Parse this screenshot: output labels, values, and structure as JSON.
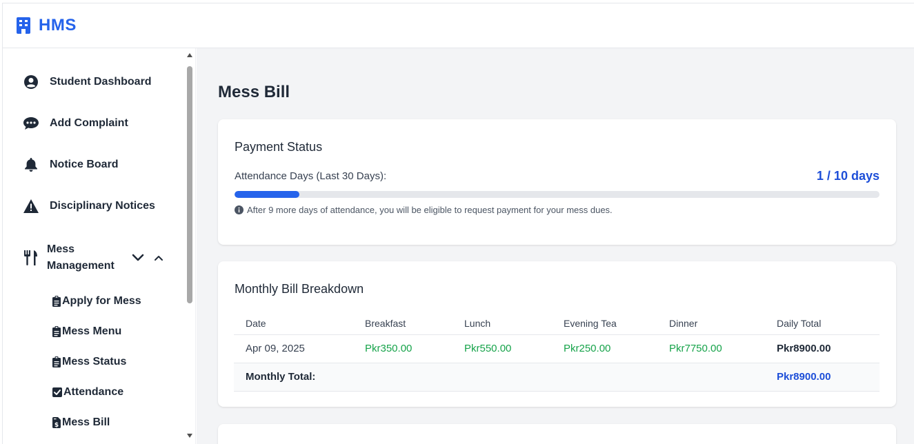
{
  "app": {
    "brand": "HMS"
  },
  "sidebar": {
    "items": [
      {
        "label": "Student Dashboard",
        "icon": "user-circle-icon"
      },
      {
        "label": "Add Complaint",
        "icon": "comment-dots-icon"
      },
      {
        "label": "Notice Board",
        "icon": "bell-icon"
      },
      {
        "label": "Disciplinary Notices",
        "icon": "warning-triangle-icon"
      }
    ],
    "mess_group": {
      "label": "Mess Management",
      "icon": "utensils-icon"
    },
    "sub_items": [
      {
        "label": "Apply for Mess",
        "icon": "clipboard-icon"
      },
      {
        "label": "Mess Menu",
        "icon": "clipboard-icon"
      },
      {
        "label": "Mess Status",
        "icon": "clipboard-icon"
      },
      {
        "label": "Attendance",
        "icon": "check-square-icon"
      },
      {
        "label": "Mess Bill",
        "icon": "file-invoice-dollar-icon"
      }
    ]
  },
  "main": {
    "title": "Mess Bill",
    "payment": {
      "title": "Payment Status",
      "attendance_label": "Attendance Days (Last 30 Days):",
      "attendance_value": "1 / 10 days",
      "progress_fraction": 0.1,
      "info": "After 9 more days of attendance, you will be eligible to request payment for your mess dues."
    },
    "breakdown": {
      "title": "Monthly Bill Breakdown",
      "headers": [
        "Date",
        "Breakfast",
        "Lunch",
        "Evening Tea",
        "Dinner",
        "Daily Total"
      ],
      "rows": [
        [
          "Apr 09, 2025",
          "Pkr350.00",
          "Pkr550.00",
          "Pkr250.00",
          "Pkr7750.00",
          "Pkr8900.00"
        ]
      ],
      "total_label": "Monthly Total:",
      "total_value": "Pkr8900.00"
    }
  },
  "colors": {
    "accent": "#2563eb",
    "green": "#16a34a",
    "text": "#1f2937"
  }
}
